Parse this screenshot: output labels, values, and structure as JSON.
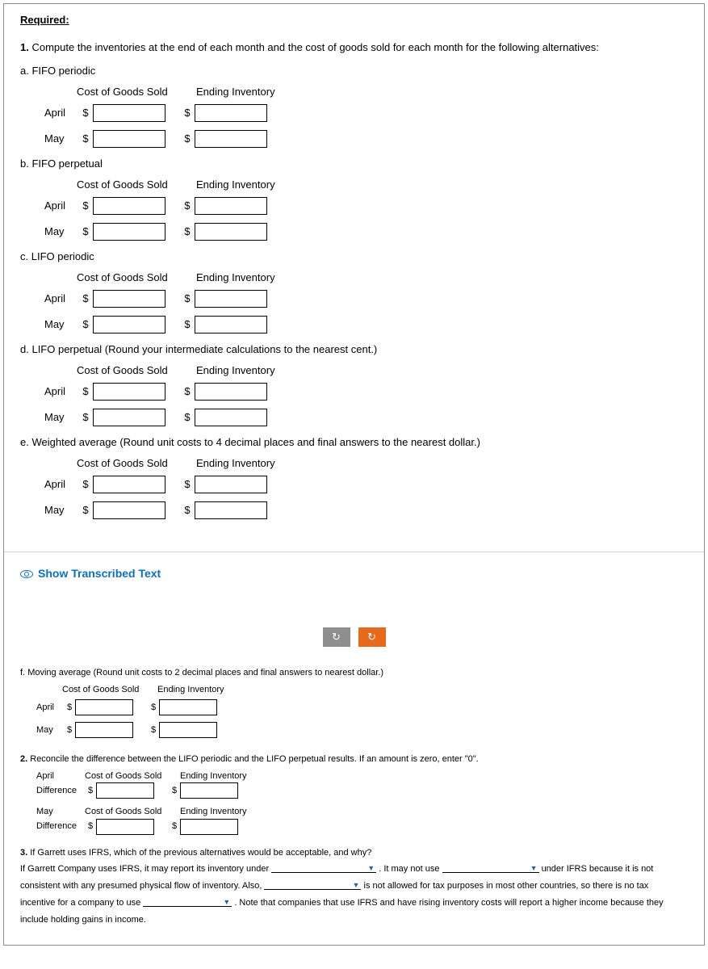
{
  "required": "Required:",
  "q1": {
    "prefix": "1.",
    "text": "Compute the inventories at the end of each month and the cost of goods sold for each month for the following alternatives:",
    "headers": {
      "cogs": "Cost of Goods Sold",
      "ei": "Ending Inventory"
    },
    "alts": {
      "a": {
        "label": "a.",
        "name": "FIFO periodic"
      },
      "b": {
        "label": "b.",
        "name": "FIFO perpetual"
      },
      "c": {
        "label": "c.",
        "name": "LIFO periodic"
      },
      "d": {
        "label": "d.",
        "name": "LIFO perpetual (Round your intermediate calculations to the nearest cent.)"
      },
      "e": {
        "label": "e.",
        "name": "Weighted average (Round unit costs to 4 decimal places and final answers to the nearest dollar.)"
      },
      "f": {
        "label": "f.",
        "name": "Moving average (Round unit costs to 2 decimal places and final answers to nearest dollar.)"
      }
    },
    "rows": {
      "april": "April",
      "may": "May"
    },
    "currency": "$"
  },
  "showTranscribed": "Show Transcribed Text",
  "q2": {
    "prefix": "2.",
    "text": "Reconcile the difference between the LIFO periodic and the LIFO perpetual results. If an amount is zero, enter \"0\".",
    "april": "April",
    "may": "May",
    "diff": "Difference",
    "headers": {
      "cogs": "Cost of Goods Sold",
      "ei": "Ending Inventory"
    },
    "currency": "$"
  },
  "q3": {
    "prefix": "3.",
    "text1": "If Garrett uses IFRS, which of the previous alternatives would be acceptable, and why?",
    "line2a": "If Garrett Company uses IFRS, it may report its inventory under ",
    "line2b": " . It may not use ",
    "line2c": " under IFRS because it is not",
    "line3a": "consistent with any presumed physical flow of inventory. Also, ",
    "line3b": " is not allowed for tax purposes in most other countries, so there is no tax",
    "line4a": "incentive for a company to use ",
    "line4b": " . Note that companies that use IFRS and have rising inventory costs will report a higher income because they",
    "line5": "include holding gains in income."
  }
}
